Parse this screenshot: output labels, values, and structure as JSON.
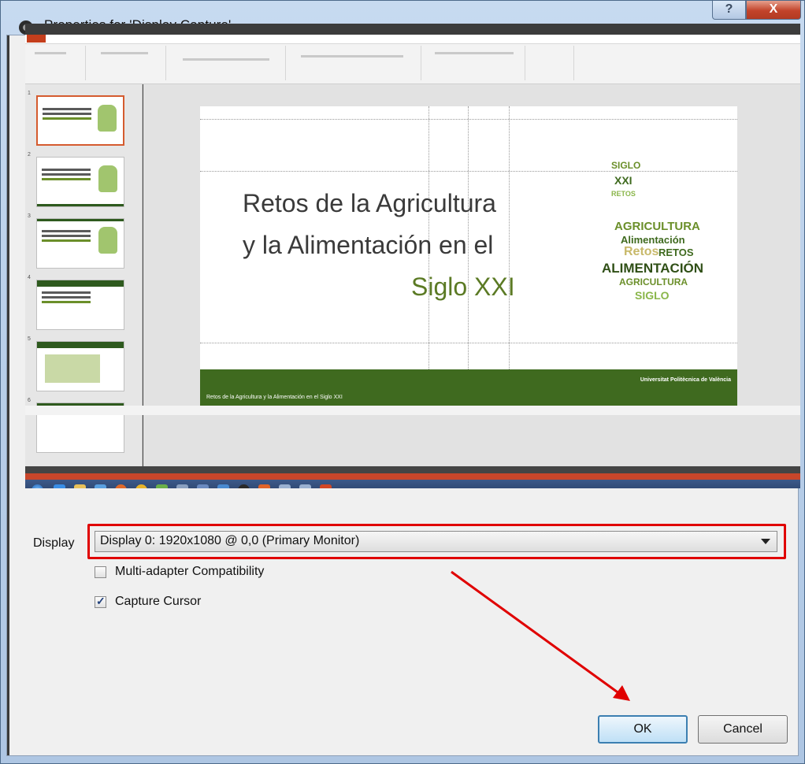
{
  "window": {
    "title": "Properties for 'Display Capture'",
    "help_glyph": "?",
    "close_glyph": "X"
  },
  "preview": {
    "slide": {
      "line1": "Retos de la Agricultura",
      "line2": "y la Alimentación en el",
      "line3": "Siglo XXI",
      "footer_left": "Retos de la Agricultura y la Alimentación en el Siglo XXI",
      "footer_right": "Universitat Politècnica de València"
    },
    "wordcloud": [
      "SIGLO",
      "XXI",
      "RETOS",
      "AGRICULTURA",
      "Alimentación",
      "Retos",
      "RETOS",
      "ALIMENTACIÓN",
      "AGRICULTURA",
      "SIGLO"
    ],
    "thumb_numbers": [
      "1",
      "2",
      "3",
      "4",
      "5",
      "6"
    ]
  },
  "display": {
    "label": "Display",
    "value": "Display 0: 1920x1080 @ 0,0 (Primary Monitor)"
  },
  "options": {
    "multi_adapter_label": "Multi-adapter Compatibility",
    "multi_adapter_checked": false,
    "capture_cursor_label": "Capture Cursor",
    "capture_cursor_checked": true
  },
  "buttons": {
    "ok": "OK",
    "cancel": "Cancel"
  },
  "colors": {
    "highlight": "#e00000",
    "slide_green": "#3f6a1f",
    "accent_green": "#5b7a24"
  }
}
